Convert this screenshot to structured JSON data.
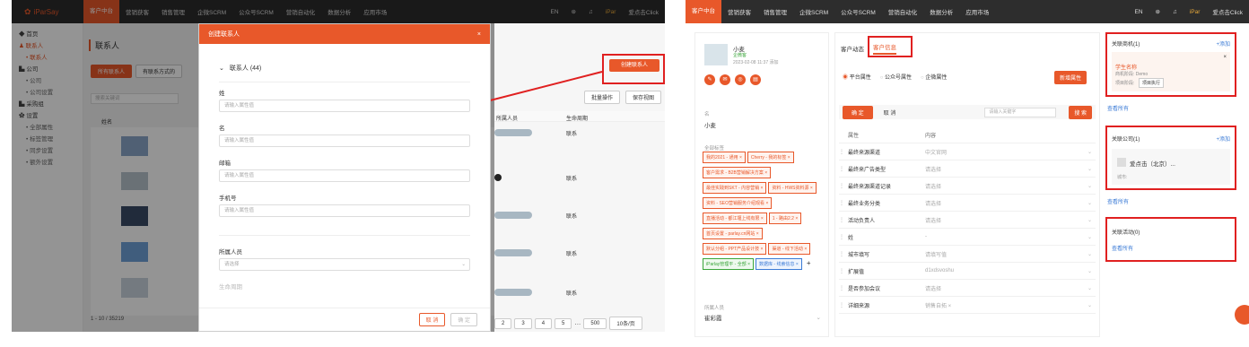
{
  "left": {
    "brand": "iParSay",
    "nav": [
      "客户中台",
      "营销获客",
      "销售管理",
      "企微SCRM",
      "公众号SCRM",
      "营销自动化",
      "数据分析",
      "应用市场"
    ],
    "nav_right": [
      "EN",
      "iPar",
      "爱点击Click"
    ],
    "sidebar": {
      "items": [
        "首页",
        "联系人",
        "联系人",
        "公司",
        "公司",
        "公司设置",
        "采购组",
        "设置",
        "全部属性",
        "标签管理",
        "同步设置",
        "额外设置"
      ]
    },
    "page_title": "联系人",
    "tabs": [
      "所有联系人",
      "有联系方式的"
    ],
    "search_placeholder": "搜索关键词",
    "col_name": "姓名",
    "col_owner": "所属人员",
    "col_stage": "生命周期",
    "rows_stage": [
      "联系",
      "联系",
      "联系",
      "联系",
      "联系",
      "联系",
      "联系"
    ],
    "create_button": "创建联系人",
    "batch_button": "批量操作",
    "view_button": "保存视图",
    "pagination": [
      "2",
      "3",
      "4",
      "5",
      "…",
      "500",
      "10条/页"
    ],
    "count": "1 - 10 / 35219",
    "modal": {
      "title": "创建联系人",
      "section": "联系人 (44)",
      "fields": [
        {
          "label": "姓",
          "placeholder": "请输入属性值"
        },
        {
          "label": "名",
          "placeholder": "请输入属性值"
        },
        {
          "label": "邮箱",
          "placeholder": "请输入属性值"
        },
        {
          "label": "手机号",
          "placeholder": "请输入属性值"
        }
      ],
      "owner_label": "所属人员",
      "owner_placeholder": "请选择",
      "stage_label": "生命周期",
      "cancel": "取 消",
      "ok": "确 定"
    }
  },
  "right": {
    "nav": [
      "客户中台",
      "营销获客",
      "销售管理",
      "企微SCRM",
      "公众号SCRM",
      "营销自动化",
      "数据分析",
      "应用市场"
    ],
    "nav_right": [
      "EN",
      "iPar",
      "爱点击Click"
    ],
    "profile": {
      "name": "小麦",
      "company": "企微客",
      "date": "2023-02-08 11:37 添加"
    },
    "name_label": "名",
    "name_value": "小麦",
    "tags_label": "全部标签",
    "tags": [
      {
        "text": "我的2021 - 通用 ×",
        "c": ""
      },
      {
        "text": "Cherry - 我的标签 ×",
        "c": ""
      },
      {
        "text": "客户需求 - B2B营销解决方案 ×",
        "c": ""
      },
      {
        "text": "最佳实践到SKT - 内容营销 ×",
        "c": ""
      },
      {
        "text": "资料 - HWS资料源 ×",
        "c": ""
      },
      {
        "text": "资料 - SEO营销服务介绍观看 ×",
        "c": ""
      },
      {
        "text": "直播活动 - 都江堰上线有限 ×",
        "c": ""
      },
      {
        "text": "1 - 路由2.2 ×",
        "c": ""
      },
      {
        "text": "首页设置 - parlay.cn网站 ×",
        "c": ""
      },
      {
        "text": "默认分组 - PPT产品设计技 ×",
        "c": ""
      },
      {
        "text": "渠道 - 线下活动 ×",
        "c": ""
      },
      {
        "text": "iParlay管理平 - 全部 ×",
        "c": "green"
      },
      {
        "text": "数据库 - 线索信息 ×",
        "c": "blue"
      }
    ],
    "owner_label": "所属人员",
    "owner_value": "崔彩霞",
    "tabs": [
      "客户动态",
      "客户信息"
    ],
    "radios": [
      "平台属性",
      "公众号属性",
      "企微属性"
    ],
    "new_prop_button": "新增属性",
    "confirm": "确 定",
    "cancel": "取 消",
    "search_placeholder": "请输入关键字",
    "search_button": "搜 索",
    "table_head": [
      "属性",
      "内容"
    ],
    "props": [
      {
        "name": "最终来源渠道",
        "value": "中文官网"
      },
      {
        "name": "最终来广告类型",
        "value": "请选择"
      },
      {
        "name": "最终来源渠道记录",
        "value": "请选择"
      },
      {
        "name": "最终业务分类",
        "value": "请选择"
      },
      {
        "name": "活动负责人",
        "value": "请选择"
      },
      {
        "name": "姓",
        "value": "-"
      },
      {
        "name": "城市填写",
        "value": "请填写值"
      },
      {
        "name": "扩展值",
        "value": "d1xdsvoshu"
      },
      {
        "name": "是否参加会议",
        "value": "请选择"
      },
      {
        "name": "详细来源",
        "value": "销售自拓 ×"
      }
    ],
    "cards": {
      "deal": {
        "title": "关联商机(1)",
        "add": "+添加",
        "item": "学生名称",
        "sub1": "商机阶段: Demo",
        "sub2": "项目阶段:",
        "stage": "项目执行",
        "all": "查看所有"
      },
      "company": {
        "title": "关联公司(1)",
        "add": "+添加",
        "name": "爱点击（北京）...",
        "meta": "城市:",
        "all": "查看所有"
      },
      "activity": {
        "title": "关联活动(0)",
        "all": "查看所有"
      }
    }
  }
}
